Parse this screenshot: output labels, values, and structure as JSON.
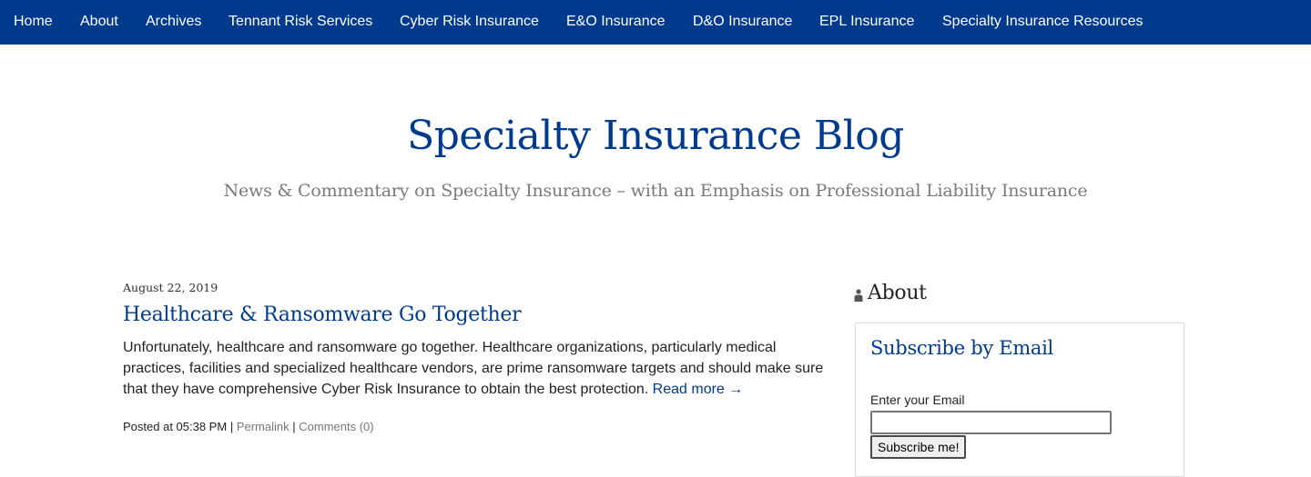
{
  "nav": {
    "items": [
      {
        "label": "Home"
      },
      {
        "label": "About"
      },
      {
        "label": "Archives"
      },
      {
        "label": "Tennant Risk Services"
      },
      {
        "label": "Cyber Risk Insurance"
      },
      {
        "label": "E&O Insurance"
      },
      {
        "label": "D&O Insurance"
      },
      {
        "label": "EPL Insurance"
      },
      {
        "label": "Specialty Insurance Resources"
      }
    ]
  },
  "header": {
    "title": "Specialty Insurance Blog",
    "tagline": "News & Commentary on Specialty Insurance – with an Emphasis on Professional Liability Insurance"
  },
  "post": {
    "date": "August 22, 2019",
    "title": "Healthcare & Ransomware Go Together",
    "excerpt": "Unfortunately, healthcare and ransomware go together. Healthcare organizations, particularly medical practices, facilities and specialized healthcare vendors, are prime ransomware targets and should make sure that they have comprehensive Cyber Risk Insurance to obtain the best protection.",
    "read_more": "Read more →",
    "posted_at": "Posted at 05:38 PM",
    "separator": "|",
    "permalink": "Permalink",
    "comments": "Comments (0)"
  },
  "sidebar": {
    "about_heading": "About",
    "about_icon": "person-icon",
    "subscribe": {
      "title": "Subscribe by Email",
      "email_label": "Enter your Email",
      "email_value": "",
      "button_label": "Subscribe me!"
    }
  },
  "colors": {
    "brand": "#003a8c",
    "tagline": "#7a7a7a",
    "meta_link": "#777777"
  }
}
